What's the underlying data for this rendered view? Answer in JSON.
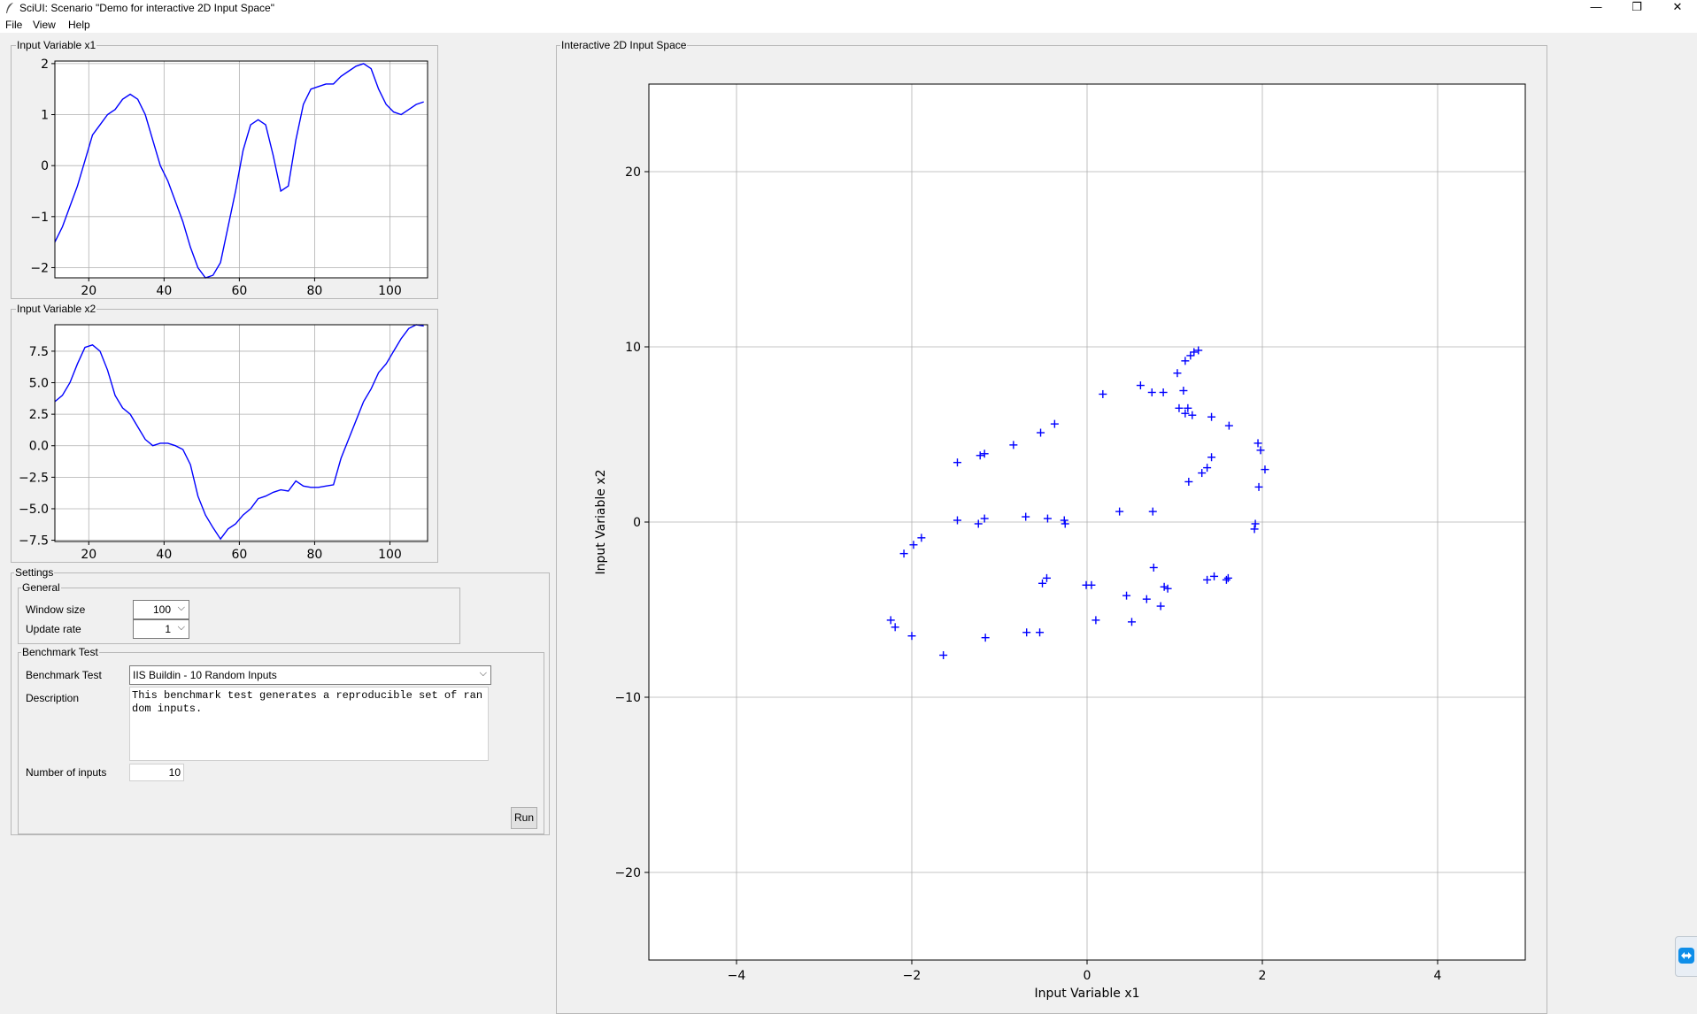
{
  "window": {
    "title": "SciUI: Scenario \"Demo for interactive 2D Input Space\"",
    "minimize_glyph": "—",
    "restore_glyph": "❐",
    "close_glyph": "✕"
  },
  "menu": [
    "File",
    "View",
    "Help"
  ],
  "plot_x1": {
    "frame_label": "Input Variable x1",
    "x_ticks": [
      "20",
      "40",
      "60",
      "80",
      "100"
    ],
    "y_ticks": [
      "2",
      "1",
      "0",
      "−1",
      "−2"
    ]
  },
  "plot_x2": {
    "frame_label": "Input Variable x2",
    "x_ticks": [
      "20",
      "40",
      "60",
      "80",
      "100"
    ],
    "y_ticks": [
      "7.5",
      "5.0",
      "2.5",
      "0.0",
      "−2.5",
      "−5.0",
      "−7.5"
    ]
  },
  "settings": {
    "frame_label": "Settings",
    "general": {
      "frame_label": "General",
      "window_size_label": "Window size",
      "window_size_value": "100",
      "update_rate_label": "Update rate",
      "update_rate_value": "1"
    },
    "benchmark": {
      "frame_label": "Benchmark Test",
      "test_label": "Benchmark Test",
      "test_value": "IIS Buildin - 10 Random Inputs",
      "description_label": "Description",
      "description_text": "This benchmark test generates a reproducible set of random inputs.",
      "num_inputs_label": "Number of inputs",
      "num_inputs_value": "10",
      "run_label": "Run"
    }
  },
  "space_2d": {
    "frame_label": "Interactive 2D Input Space",
    "xlabel": "Input Variable x1",
    "ylabel": "Input Variable x2",
    "x_ticks": [
      "−4",
      "−2",
      "0",
      "2",
      "4"
    ],
    "y_ticks": [
      "20",
      "10",
      "0",
      "−10",
      "−20"
    ]
  },
  "chart_data": [
    {
      "type": "line",
      "xlim": [
        11,
        110
      ],
      "ylim": [
        -2.2,
        2.05
      ],
      "color": "#0000ff",
      "grid": true,
      "x": [
        11,
        13,
        15,
        17,
        19,
        21,
        23,
        25,
        27,
        29,
        31,
        33,
        35,
        37,
        39,
        41,
        43,
        45,
        47,
        49,
        51,
        53,
        55,
        57,
        59,
        61,
        63,
        65,
        67,
        69,
        71,
        73,
        75,
        77,
        79,
        81,
        83,
        85,
        87,
        89,
        91,
        93,
        95,
        97,
        99,
        101,
        103,
        105,
        107,
        109
      ],
      "y": [
        -1.5,
        -1.2,
        -0.8,
        -0.4,
        0.1,
        0.6,
        0.8,
        1.0,
        1.1,
        1.3,
        1.4,
        1.3,
        1.0,
        0.5,
        0.0,
        -0.3,
        -0.7,
        -1.1,
        -1.6,
        -2.0,
        -2.2,
        -2.15,
        -1.9,
        -1.2,
        -0.5,
        0.3,
        0.8,
        0.9,
        0.8,
        0.2,
        -0.5,
        -0.4,
        0.5,
        1.2,
        1.5,
        1.55,
        1.6,
        1.6,
        1.75,
        1.85,
        1.95,
        2.0,
        1.9,
        1.5,
        1.2,
        1.05,
        1.0,
        1.1,
        1.2,
        1.25
      ]
    },
    {
      "type": "line",
      "xlim": [
        11,
        110
      ],
      "ylim": [
        -7.6,
        9.6
      ],
      "color": "#0000ff",
      "grid": true,
      "x": [
        11,
        13,
        15,
        17,
        19,
        21,
        23,
        25,
        27,
        29,
        31,
        33,
        35,
        37,
        39,
        41,
        43,
        45,
        47,
        49,
        51,
        53,
        55,
        57,
        59,
        61,
        63,
        65,
        67,
        69,
        71,
        73,
        75,
        77,
        79,
        81,
        83,
        85,
        87,
        89,
        91,
        93,
        95,
        97,
        99,
        101,
        103,
        105,
        107,
        109
      ],
      "y": [
        3.5,
        4.0,
        5.0,
        6.5,
        7.8,
        8.0,
        7.5,
        6.0,
        4.0,
        3.0,
        2.5,
        1.5,
        0.5,
        0.0,
        0.2,
        0.2,
        0.0,
        -0.3,
        -1.5,
        -4.0,
        -5.5,
        -6.5,
        -7.4,
        -6.6,
        -6.2,
        -5.5,
        -5.0,
        -4.2,
        -4.0,
        -3.7,
        -3.5,
        -3.6,
        -2.8,
        -3.2,
        -3.3,
        -3.3,
        -3.2,
        -3.1,
        -1.0,
        0.5,
        2.0,
        3.5,
        4.5,
        5.8,
        6.5,
        7.5,
        8.5,
        9.3,
        9.6,
        9.5
      ]
    },
    {
      "type": "scatter",
      "marker": "+",
      "color": "#0000ff",
      "grid": true,
      "xlim": [
        -5,
        5
      ],
      "ylim": [
        -25,
        25
      ],
      "xlabel": "Input Variable x1",
      "ylabel": "Input Variable x2",
      "points": [
        [
          1.27,
          9.8
        ],
        [
          1.22,
          9.7
        ],
        [
          1.18,
          9.5
        ],
        [
          1.12,
          9.2
        ],
        [
          1.03,
          8.5
        ],
        [
          0.61,
          7.8
        ],
        [
          0.74,
          7.4
        ],
        [
          0.87,
          7.4
        ],
        [
          1.1,
          7.5
        ],
        [
          0.18,
          7.3
        ],
        [
          1.05,
          6.5
        ],
        [
          1.15,
          6.5
        ],
        [
          1.12,
          6.2
        ],
        [
          1.2,
          6.1
        ],
        [
          1.42,
          6.0
        ],
        [
          1.62,
          5.5
        ],
        [
          -0.37,
          5.6
        ],
        [
          -0.53,
          5.1
        ],
        [
          -0.84,
          4.4
        ],
        [
          -1.17,
          3.9
        ],
        [
          -1.22,
          3.8
        ],
        [
          -1.48,
          3.4
        ],
        [
          1.95,
          4.5
        ],
        [
          1.98,
          4.1
        ],
        [
          1.42,
          3.7
        ],
        [
          1.37,
          3.1
        ],
        [
          1.31,
          2.8
        ],
        [
          2.03,
          3.0
        ],
        [
          1.16,
          2.3
        ],
        [
          1.96,
          2.0
        ],
        [
          -1.48,
          0.1
        ],
        [
          -1.24,
          -0.1
        ],
        [
          -1.17,
          0.2
        ],
        [
          -0.7,
          0.3
        ],
        [
          -0.45,
          0.2
        ],
        [
          -0.25,
          -0.1
        ],
        [
          -0.26,
          0.1
        ],
        [
          0.37,
          0.6
        ],
        [
          0.75,
          0.6
        ],
        [
          1.92,
          -0.1
        ],
        [
          1.91,
          -0.4
        ],
        [
          -1.89,
          -0.9
        ],
        [
          -1.98,
          -1.3
        ],
        [
          -2.09,
          -1.8
        ],
        [
          0.76,
          -2.6
        ],
        [
          0.88,
          -3.7
        ],
        [
          0.92,
          -3.8
        ],
        [
          1.37,
          -3.3
        ],
        [
          1.45,
          -3.1
        ],
        [
          1.59,
          -3.3
        ],
        [
          1.61,
          -3.2
        ],
        [
          -0.46,
          -3.2
        ],
        [
          -0.51,
          -3.5
        ],
        [
          -0.01,
          -3.6
        ],
        [
          0.05,
          -3.6
        ],
        [
          0.45,
          -4.2
        ],
        [
          0.68,
          -4.4
        ],
        [
          0.84,
          -4.8
        ],
        [
          -2.24,
          -5.6
        ],
        [
          -2.19,
          -6.0
        ],
        [
          -2.0,
          -6.5
        ],
        [
          -1.16,
          -6.6
        ],
        [
          -0.69,
          -6.3
        ],
        [
          -0.54,
          -6.3
        ],
        [
          0.1,
          -5.6
        ],
        [
          0.51,
          -5.7
        ],
        [
          -1.64,
          -7.6
        ]
      ]
    }
  ]
}
